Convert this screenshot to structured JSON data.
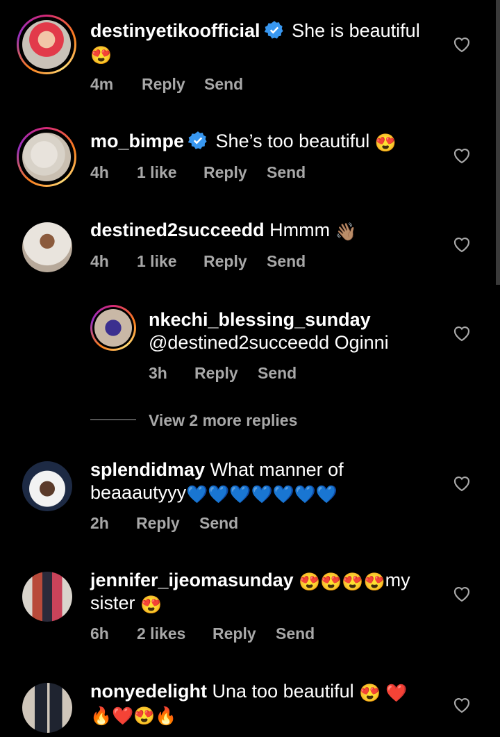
{
  "comments": [
    {
      "username": "destinyetikoofficial",
      "verified": true,
      "text": "She is beautiful",
      "emoji_after": "😍",
      "time": "4m",
      "likes": "",
      "reply": "Reply",
      "send": "Send"
    },
    {
      "username": "mo_bimpe",
      "verified": true,
      "text": "She’s too beautiful",
      "emoji_after": "😍",
      "time": "4h",
      "likes": "1 like",
      "reply": "Reply",
      "send": "Send"
    },
    {
      "username": "destined2succeedd",
      "verified": false,
      "text": "Hmmm",
      "emoji_after": "👋🏽",
      "time": "4h",
      "likes": "1 like",
      "reply": "Reply",
      "send": "Send"
    },
    {
      "username": "nkechi_blessing_sunday",
      "verified": false,
      "text": "@destined2succeedd Oginni",
      "emoji_after": "",
      "time": "3h",
      "likes": "",
      "reply": "Reply",
      "send": "Send"
    },
    {
      "username": "splendidmay",
      "verified": false,
      "text": "What manner of beaaautyyy",
      "emoji_after": "💙💙💙💙💙💙💙",
      "time": "2h",
      "likes": "",
      "reply": "Reply",
      "send": "Send"
    },
    {
      "username": "jennifer_ijeomasunday",
      "verified": false,
      "text_emoji": "😍😍😍😍",
      "text": "my sister",
      "emoji_after": "😍",
      "time": "6h",
      "likes": "2 likes",
      "reply": "Reply",
      "send": "Send"
    },
    {
      "username": "nonyedelight",
      "verified": false,
      "text": "Una too beautiful",
      "emoji_after": "😍 ❤️",
      "emoji_line2": "🔥❤️😍🔥",
      "time": "",
      "likes": "",
      "reply": "",
      "send": ""
    }
  ],
  "view_more_replies": "View 2 more replies",
  "icons": {
    "heart": "heart-outline-icon",
    "verified": "verified-badge-icon"
  },
  "colors": {
    "background": "#000000",
    "text": "#ffffff",
    "muted": "#a8a8a8",
    "verified": "#3897f0"
  }
}
